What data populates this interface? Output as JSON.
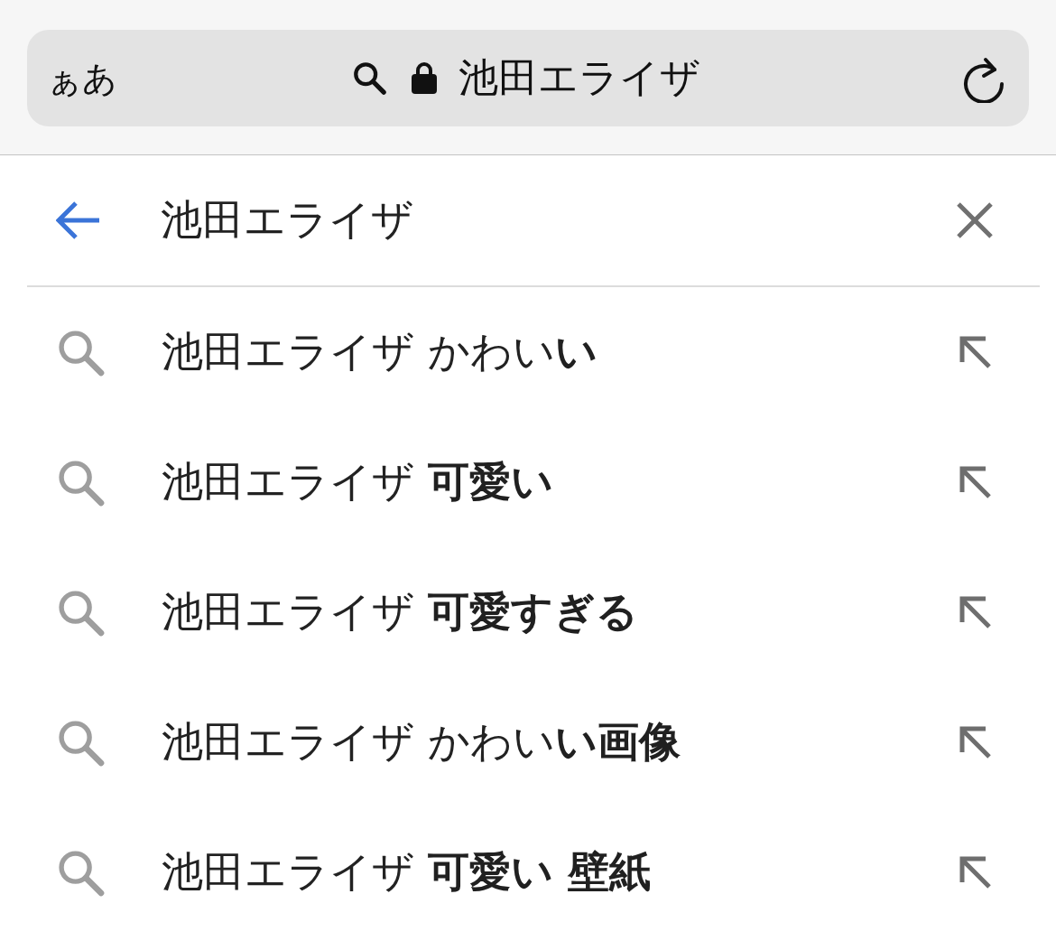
{
  "address_bar": {
    "text_size_button": "ぁあ",
    "url_text": "池田エライザ"
  },
  "search": {
    "value": "池田エライザ"
  },
  "suggestions": [
    {
      "text": "池田エライザ かわい**い**"
    },
    {
      "text": "池田エライザ **可愛い**"
    },
    {
      "text": "池田エライザ **可愛すぎる**"
    },
    {
      "text": "池田エライザ かわい**い画像**"
    },
    {
      "text": "池田エライザ **可愛い 壁紙**"
    }
  ]
}
